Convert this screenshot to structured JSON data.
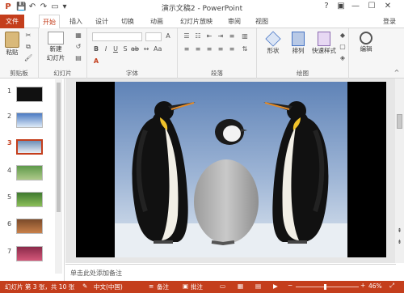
{
  "app": {
    "title": "演示文稿2 - PowerPoint",
    "signin": "登录"
  },
  "colors": {
    "accent": "#c43e1c",
    "ribbon_bg": "#f6f6f6"
  },
  "tabs": [
    "文件",
    "开始",
    "插入",
    "设计",
    "切换",
    "动画",
    "幻灯片放映",
    "审阅",
    "视图"
  ],
  "ribbon": {
    "clipboard": {
      "paste": "粘贴",
      "group": "剪贴板"
    },
    "slides": {
      "new_slide": "新建",
      "new_slide2": "幻灯片",
      "group": "幻灯片"
    },
    "font": {
      "group": "字体"
    },
    "paragraph": {
      "group": "段落"
    },
    "drawing": {
      "shape": "形状",
      "arrange": "排列",
      "quick_styles": "快速样式",
      "group": "绘图"
    },
    "editing": {
      "label": "编辑"
    }
  },
  "thumbnails": [
    "1",
    "2",
    "3",
    "4",
    "5",
    "6",
    "7"
  ],
  "selected_slide": "3",
  "notes_placeholder": "单击此处添加备注",
  "status": {
    "slide_info": "幻灯片 第 3 张，共 10 张",
    "language": "中文(中国)",
    "notes": "备注",
    "comments": "批注",
    "zoom": "46%"
  }
}
